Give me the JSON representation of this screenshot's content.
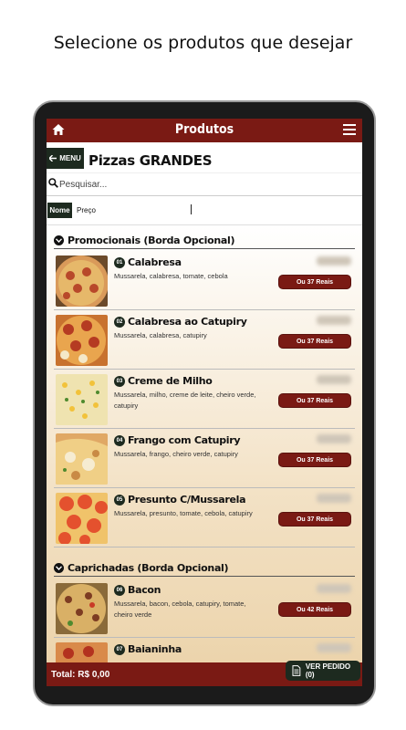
{
  "headline": "Selecione os produtos que desejar",
  "appbar": {
    "title": "Produtos",
    "home_icon": "home-icon",
    "menu_icon": "hamburger-icon"
  },
  "titlebar": {
    "menu_label": "MENU",
    "page_title": "Pizzas GRANDES"
  },
  "search": {
    "placeholder": "Pesquisar..."
  },
  "sort": {
    "nome": "Nome",
    "preco": "Preço"
  },
  "sections": [
    {
      "title": "Promocionais (Borda Opcional)",
      "items": [
        {
          "num": "01",
          "name": "Calabresa",
          "desc": "Mussarela, calabresa, tomate, cebola",
          "button": "Ou 37 Reais"
        },
        {
          "num": "02",
          "name": "Calabresa ao Catupiry",
          "desc": "Mussarela, calabresa, catupiry",
          "button": "Ou 37 Reais"
        },
        {
          "num": "03",
          "name": "Creme de Milho",
          "desc": "Mussarela, milho, creme de leite, cheiro verde, catupiry",
          "button": "Ou 37 Reais"
        },
        {
          "num": "04",
          "name": "Frango com Catupiry",
          "desc": "Mussarela, frango, cheiro verde, catupiry",
          "button": "Ou 37 Reais"
        },
        {
          "num": "05",
          "name": "Presunto C/Mussarela",
          "desc": "Mussarela, presunto, tomate, cebola, catupiry",
          "button": "Ou 37 Reais"
        }
      ]
    },
    {
      "title": "Caprichadas (Borda Opcional)",
      "items": [
        {
          "num": "06",
          "name": "Bacon",
          "desc": "Mussarela, bacon, cebola, catupiry, tomate, cheiro verde",
          "button": "Ou 42 Reais"
        },
        {
          "num": "07",
          "name": "Baianinha",
          "desc": "",
          "button": ""
        }
      ]
    }
  ],
  "footer": {
    "total": "Total: R$ 0,00",
    "order_button": "VER PEDIDO (0)"
  },
  "colors": {
    "primary": "#7a1a14",
    "dark": "#1d2a1f"
  }
}
